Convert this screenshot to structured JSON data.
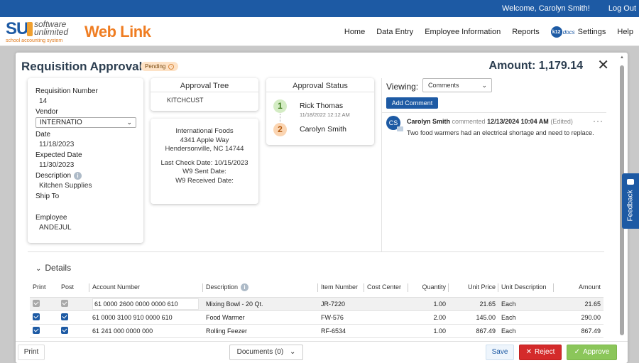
{
  "topbar": {
    "welcome": "Welcome, Carolyn Smith!",
    "logout": "Log Out"
  },
  "brand": {
    "logo_mark": "SU",
    "logo_line1": "software",
    "logo_line2": "unlimited",
    "logo_tagline": "school accounting system",
    "app_name": "Web Link"
  },
  "nav": {
    "home": "Home",
    "data_entry": "Data Entry",
    "employee_info": "Employee Information",
    "reports": "Reports",
    "k12_mark": "k12",
    "k12_docs": "docs",
    "settings": "Settings",
    "help": "Help"
  },
  "modal": {
    "title": "Requisition Approval -",
    "status_badge": "Pending",
    "amount": "Amount: 1,179.14",
    "close_glyph": "✕"
  },
  "info": {
    "req_number_label": "Requisition Number",
    "req_number": "14",
    "vendor_label": "Vendor",
    "vendor": "INTERNATIO",
    "date_label": "Date",
    "date": "11/18/2023",
    "expected_label": "Expected Date",
    "expected": "11/30/2023",
    "description_label": "Description",
    "description": "Kitchen Supplies",
    "ship_to_label": "Ship To",
    "ship_to": "",
    "employee_label": "Employee",
    "employee": "ANDEJUL"
  },
  "approval_tree": {
    "header": "Approval Tree",
    "value": "KITCHCUST"
  },
  "vendor_address": {
    "name": "International Foods",
    "street": "4341 Apple Way",
    "city": "Hendersonville, NC 14744",
    "last_check": "Last Check Date: 10/15/2023",
    "w9_sent": "W9 Sent Date:",
    "w9_received": "W9 Received Date:"
  },
  "approval_status": {
    "header": "Approval Status",
    "steps": [
      {
        "num": "1",
        "name": "Rick Thomas",
        "date": "11/18/2022 12:12 AM"
      },
      {
        "num": "2",
        "name": "Carolyn Smith",
        "date": ""
      }
    ]
  },
  "comments": {
    "viewing_label": "Viewing:",
    "viewing_value": "Comments",
    "add_button": "Add Comment",
    "avatar_initials": "CS",
    "author": "Carolyn Smith",
    "verb": "commented",
    "datetime": "12/13/2024 10:04 AM",
    "edited": "(Edited)",
    "text": "Two food warmers had an electrical shortage and need to replace.",
    "menu_glyph": "···"
  },
  "details": {
    "label": "Details",
    "columns": [
      "Print",
      "Post",
      "Account Number",
      "Description",
      "Item Number",
      "Cost Center",
      "Quantity",
      "Unit Price",
      "Unit Description",
      "Amount"
    ],
    "rows": [
      {
        "print": false,
        "post": false,
        "account": "61 0000 2600 0000 0000 610",
        "description": "Mixing Bowl - 20 Qt.",
        "item": "JR-7220",
        "cost_center": "",
        "quantity": "1.00",
        "unit_price": "21.65",
        "unit_desc": "Each",
        "amount": "21.65"
      },
      {
        "print": true,
        "post": true,
        "account": "61 0000 3100 910 0000 610",
        "description": "Food Warmer",
        "item": "FW-576",
        "cost_center": "",
        "quantity": "2.00",
        "unit_price": "145.00",
        "unit_desc": "Each",
        "amount": "290.00"
      },
      {
        "print": true,
        "post": true,
        "account": "61 241 000 0000 000",
        "description": "Rolling Feezer",
        "item": "RF-6534",
        "cost_center": "",
        "quantity": "1.00",
        "unit_price": "867.49",
        "unit_desc": "Each",
        "amount": "867.49"
      }
    ]
  },
  "footer": {
    "print": "Print",
    "documents": "Documents (0)",
    "save": "Save",
    "reject": "Reject",
    "approve": "Approve"
  },
  "feedback": {
    "label": "Feedback"
  },
  "colors": {
    "brand_blue": "#1d5aa4",
    "brand_orange": "#ef7d22",
    "reject_red": "#d42b2b",
    "approve_green": "#8bc65a"
  }
}
